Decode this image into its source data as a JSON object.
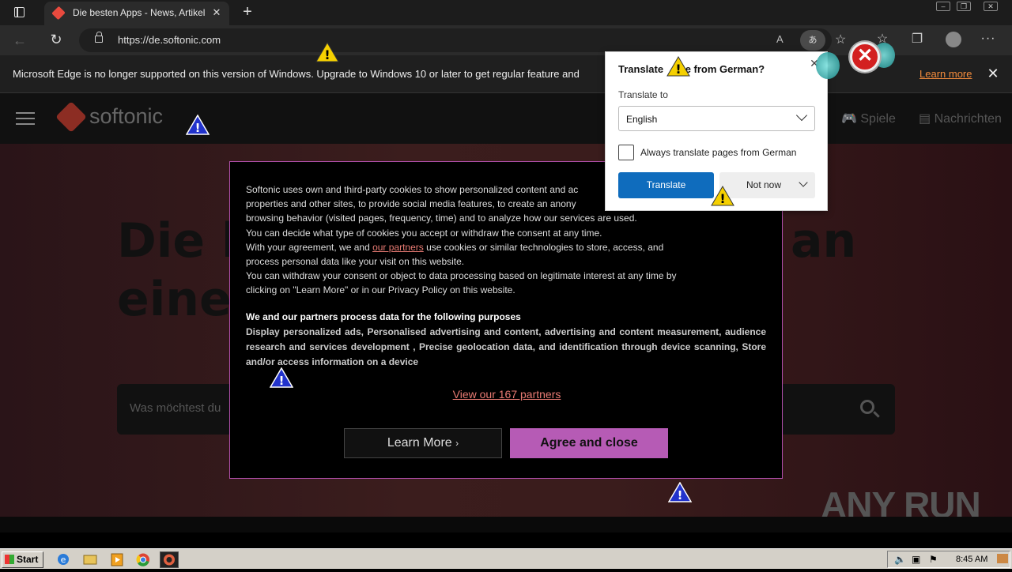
{
  "browser": {
    "tab_title": "Die besten Apps - News, Artikel",
    "url": "https://de.softonic.com",
    "read_aloud": "A",
    "translate_glyph": "あ"
  },
  "infobar": {
    "message": "Microsoft Edge is no longer supported on this version of Windows. Upgrade to Windows 10 or later to get regular feature and",
    "learn_more": "Learn more"
  },
  "site": {
    "logo": "softonic",
    "nav_games": "Spiele",
    "nav_news": "Nachrichten",
    "hero_line1_start": "Die l",
    "hero_line1_end": "an",
    "hero_line2": "eine",
    "search_placeholder": "Was möchtest du"
  },
  "cookie": {
    "p1": "Softonic uses own and third-party cookies to show personalized content and ac",
    "p1b": "properties and other sites, to provide social media features, to create an anony",
    "p1c": "browsing behavior (visited pages, frequency, time) and to analyze how our services are used.",
    "p2": "You can decide what type of cookies you accept or withdraw the consent at any time.",
    "p3a": "With your agreement, we and ",
    "p3_link": "our partners",
    "p3b": " use cookies or similar technologies to store, access, and",
    "p3c": "process personal data like your visit on this website.",
    "p4": "You can withdraw your consent or object to data processing based on legitimate interest at any time by",
    "p4b": "clicking on \"Learn More\" or in our Privacy Policy on this website.",
    "purposes_title": "We and our partners process data for the following purposes",
    "purposes_text": "Display personalized ads, Personalised advertising and content, advertising and content measurement, audience research and services development , Precise geolocation data, and identification through device scanning, Store and/or access information on a device",
    "partners_link": "View our 167 partners",
    "learn_more_btn": "Learn More",
    "learn_more_chev": "›",
    "agree_btn": "Agree and close"
  },
  "translate": {
    "title_start": "Translate ",
    "title_end": "e from German?",
    "label": "Translate to",
    "language": "English",
    "always_label": "Always translate pages from German",
    "translate_btn": "Translate",
    "not_now_btn": "Not now"
  },
  "taskbar": {
    "start": "Start",
    "clock": "8:45 AM"
  },
  "watermark": "ANY RUN",
  "colors": {
    "accent_purple": "#b65bb5",
    "link_red": "#e87b73",
    "edge_blue": "#0f6cbd"
  }
}
